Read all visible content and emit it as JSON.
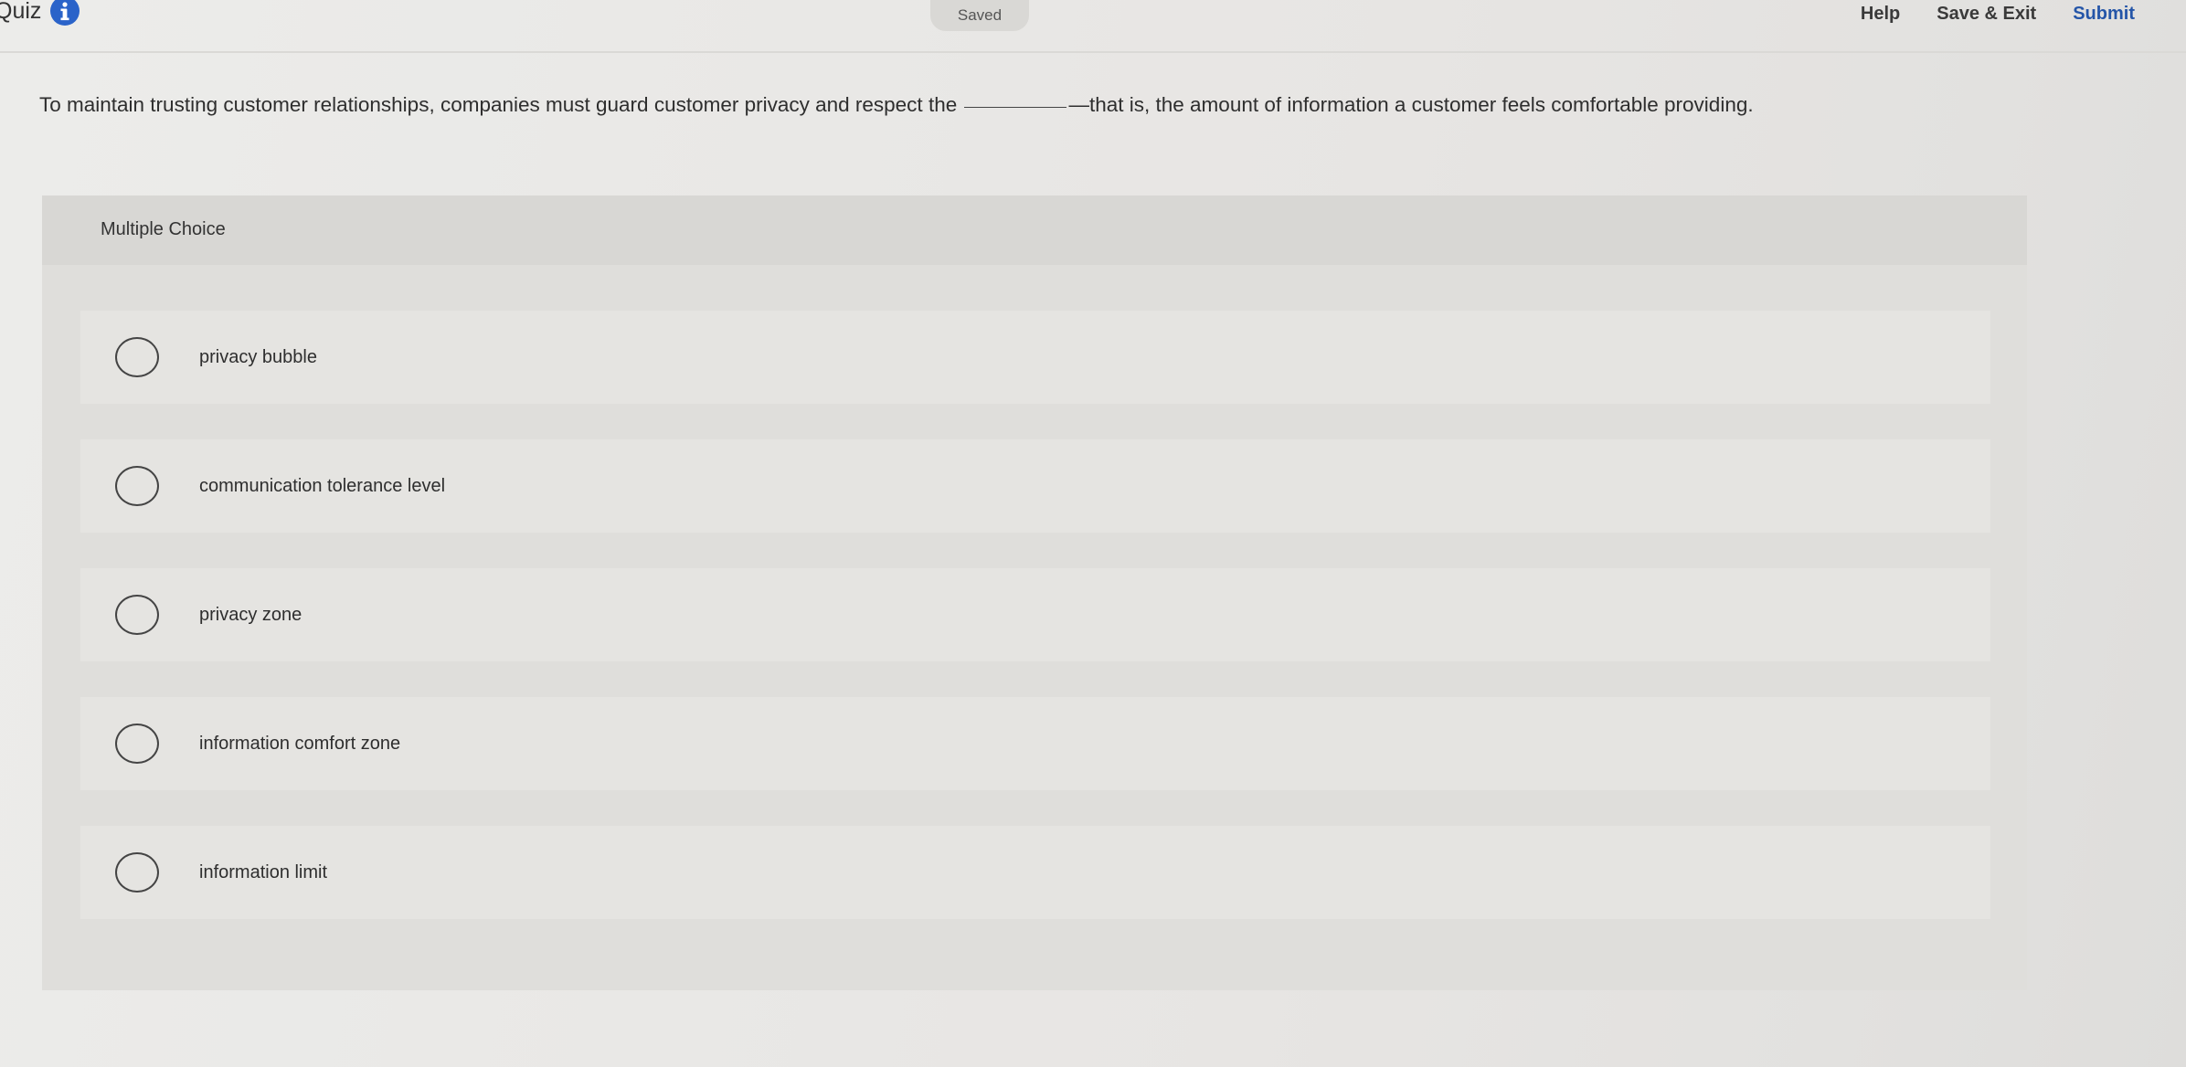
{
  "header": {
    "title": "Quiz",
    "info_icon": "info-icon",
    "status": "Saved",
    "actions": {
      "help": "Help",
      "save_exit": "Save & Exit",
      "submit": "Submit"
    }
  },
  "question": {
    "text_before": "To maintain trusting customer relationships, companies must guard customer privacy and respect the",
    "text_after": "—that is, the amount of information a customer feels comfortable providing."
  },
  "multiple_choice": {
    "label": "Multiple Choice",
    "options": [
      "privacy bubble",
      "communication tolerance level",
      "privacy zone",
      "information comfort zone",
      "information limit"
    ]
  },
  "colors": {
    "accent": "#2455a8",
    "info_icon": "#2a63c9"
  }
}
